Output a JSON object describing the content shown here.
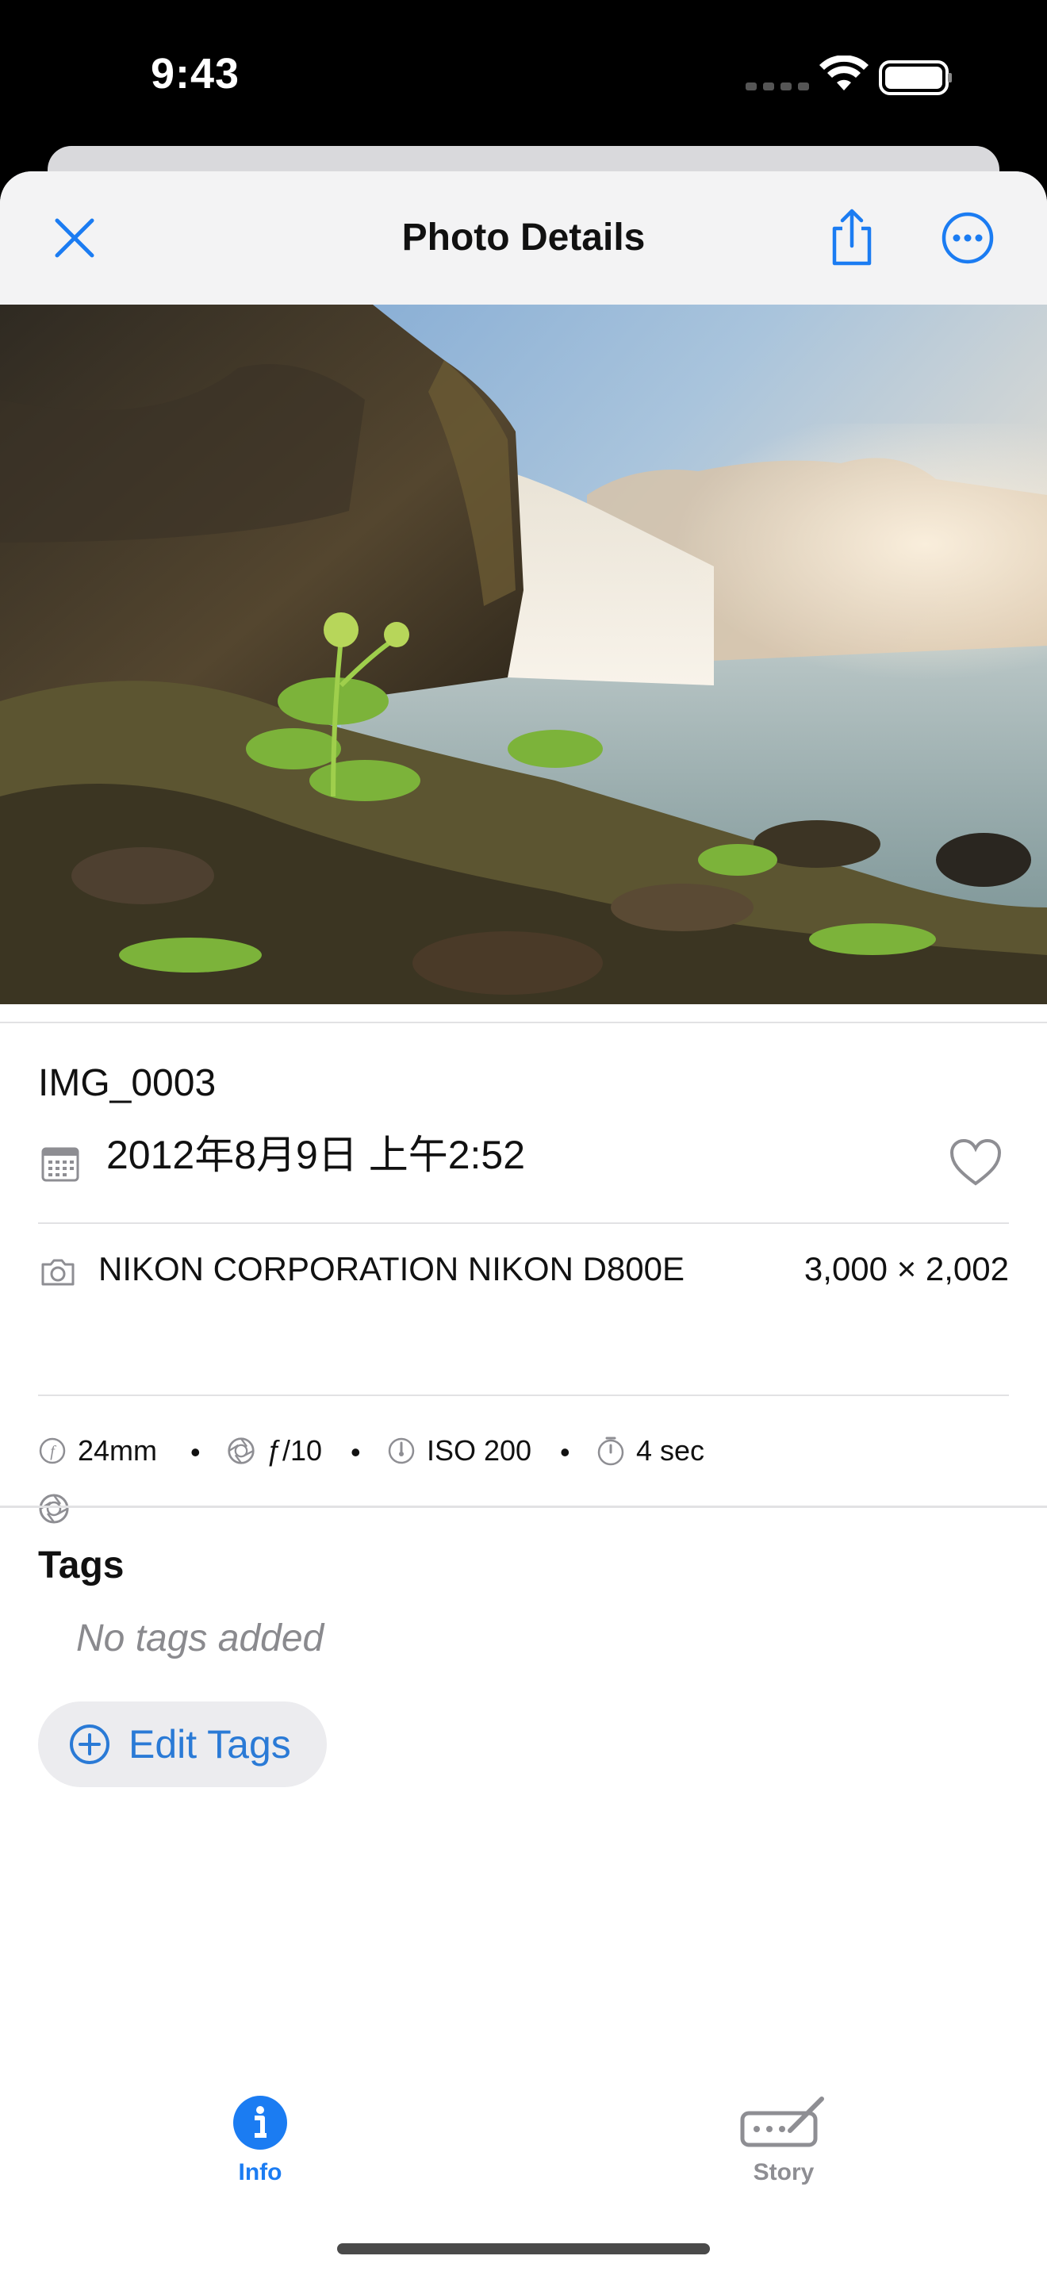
{
  "status_bar": {
    "time": "9:43"
  },
  "nav": {
    "title": "Photo Details"
  },
  "photo": {
    "filename": "IMG_0003",
    "date": "2012年8月9日 上午2:52",
    "favorite": false
  },
  "camera": {
    "model": "NIKON CORPORATION NIKON D800E",
    "dimensions": "3,000 × 2,002"
  },
  "exif": {
    "focal_length": "24mm",
    "aperture": "ƒ/10",
    "iso": "ISO 200",
    "shutter": "4 sec"
  },
  "tags": {
    "title": "Tags",
    "empty_text": "No tags added",
    "edit_label": "Edit Tags"
  },
  "tabs": [
    {
      "label": "Info",
      "active": true
    },
    {
      "label": "Story",
      "active": false
    }
  ],
  "colors": {
    "accent": "#1b7cf2",
    "link": "#2a7ad6",
    "inactive": "#8e8e93"
  }
}
